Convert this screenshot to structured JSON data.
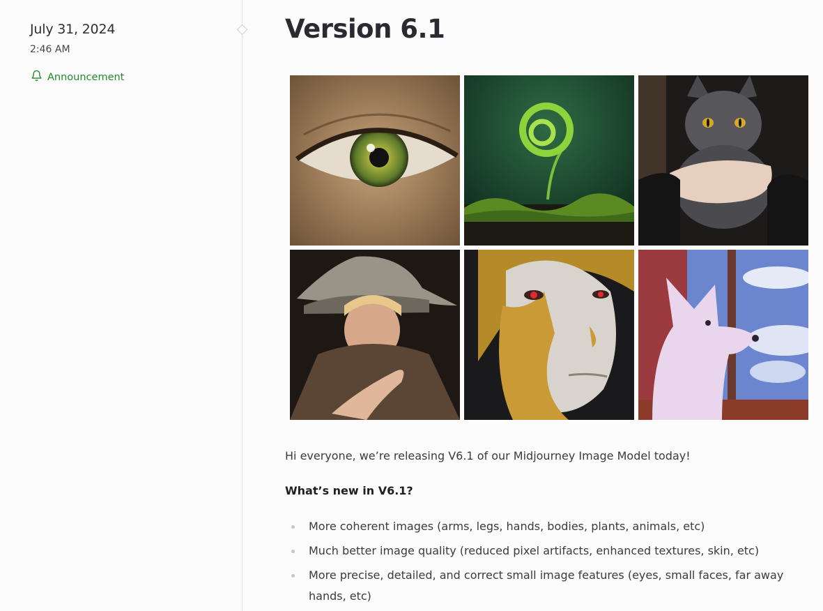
{
  "post": {
    "date": "July 31, 2024",
    "time": "2:46 AM",
    "category": {
      "label": "Announcement",
      "icon": "bell-icon",
      "color": "#1f8a2c"
    },
    "title": "Version 6.1",
    "images": [
      {
        "name": "image-green-eye"
      },
      {
        "name": "image-fern-sprout"
      },
      {
        "name": "image-gray-cat"
      },
      {
        "name": "image-witch-portrait"
      },
      {
        "name": "image-gold-face"
      },
      {
        "name": "image-pixel-wolf"
      }
    ],
    "intro": "Hi everyone, we’re releasing V6.1 of our Midjourney Image Model today!",
    "whats_new_heading": "What’s new in V6.1?",
    "bullets": [
      "More coherent images (arms, legs, hands, bodies, plants, animals, etc)",
      "Much better image quality (reduced pixel artifacts, enhanced textures, skin, etc)",
      "More precise, detailed, and correct small image features (eyes, small faces, far away hands, etc)"
    ]
  }
}
